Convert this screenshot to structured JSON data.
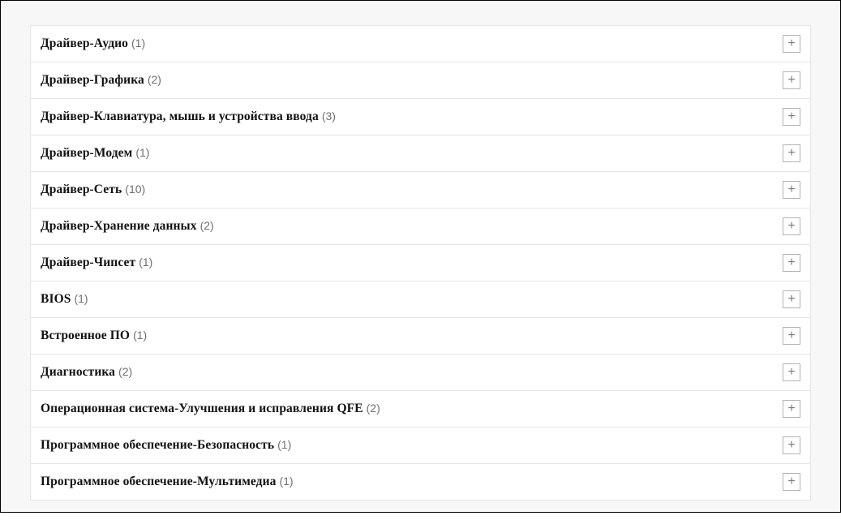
{
  "categories": [
    {
      "title": "Драйвер-Аудио",
      "count": 1
    },
    {
      "title": "Драйвер-Графика",
      "count": 2
    },
    {
      "title": "Драйвер-Клавиатура, мышь и устройства ввода",
      "count": 3
    },
    {
      "title": "Драйвер-Модем",
      "count": 1
    },
    {
      "title": "Драйвер-Сеть",
      "count": 10
    },
    {
      "title": "Драйвер-Хранение данных",
      "count": 2
    },
    {
      "title": "Драйвер-Чипсет",
      "count": 1
    },
    {
      "title": "BIOS",
      "count": 1
    },
    {
      "title": "Встроенное ПО",
      "count": 1
    },
    {
      "title": "Диагностика",
      "count": 2
    },
    {
      "title": "Операционная система-Улучшения и исправления QFE",
      "count": 2
    },
    {
      "title": "Программное обеспечение-Безопасность",
      "count": 1
    },
    {
      "title": "Программное обеспечение-Мультимедиа",
      "count": 1
    }
  ],
  "icons": {
    "expand": "+"
  }
}
